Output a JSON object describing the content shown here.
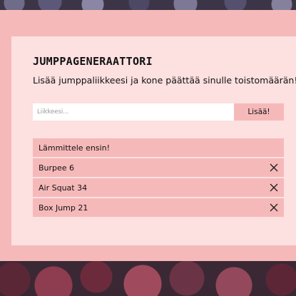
{
  "app": {
    "title": "JUMPPAGENERAATTORI",
    "subtitle": "Lisää jumppaliikkeesi ja kone päättää sinulle toistomäärän!"
  },
  "form": {
    "placeholder": "Liikkeesi...",
    "value": "",
    "add_label": "Lisää!"
  },
  "list": {
    "items": [
      {
        "label": "Lämmittele ensin!",
        "removable": false
      },
      {
        "label": "Burpee 6",
        "removable": true,
        "icon": "close-icon"
      },
      {
        "label": "Air Squat 34",
        "removable": true,
        "icon": "close-icon"
      },
      {
        "label": "Box Jump 21",
        "removable": true,
        "icon": "close-icon"
      }
    ]
  },
  "colors": {
    "outer_background": "#f6b9ba",
    "card_background": "#fde0e0",
    "accent": "#f6b9ba"
  }
}
